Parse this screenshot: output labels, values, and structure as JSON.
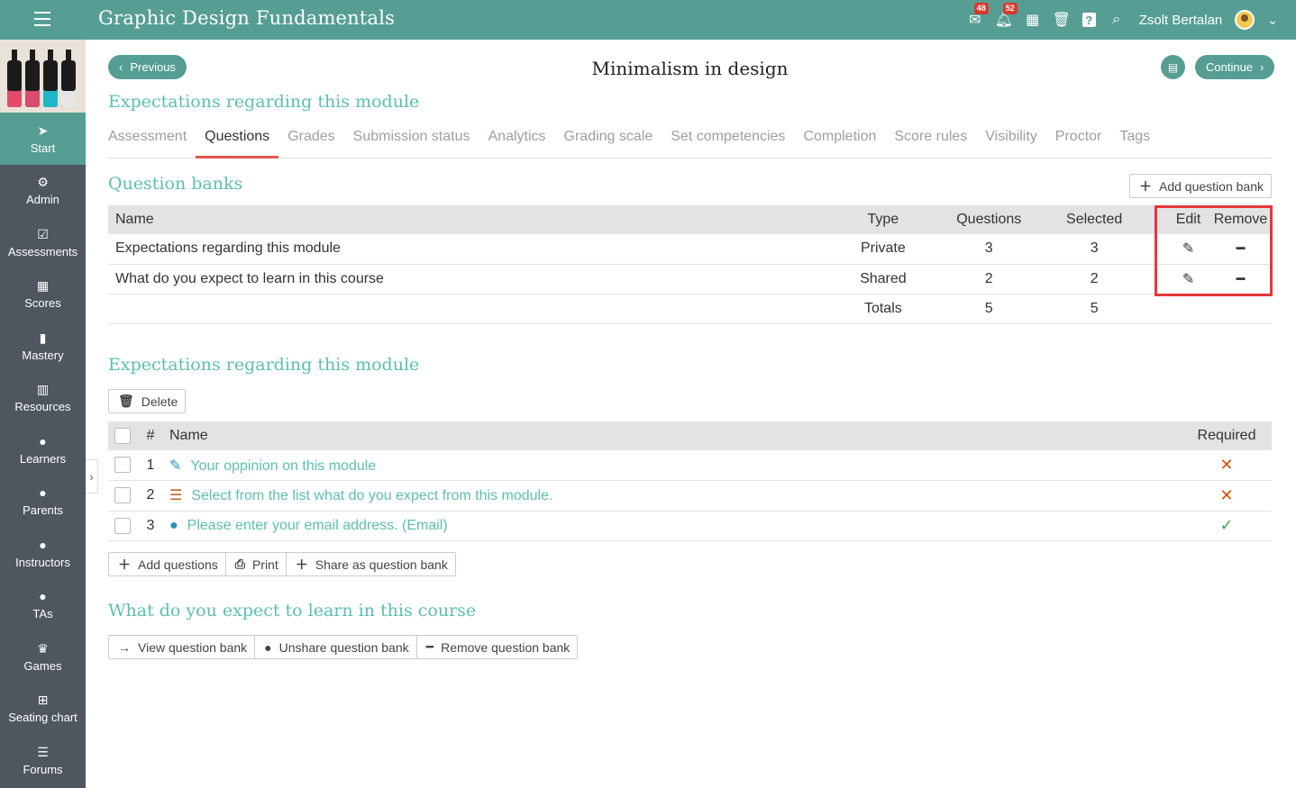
{
  "header": {
    "title": "Graphic Design Fundamentals",
    "messages_badge": "48",
    "notifications_badge": "52",
    "user_name": "Zsolt Bertalan"
  },
  "sidebar": {
    "items": [
      {
        "label": "Start",
        "icon": "➤"
      },
      {
        "label": "Admin",
        "icon": "⚙"
      },
      {
        "label": "Assessments",
        "icon": "☑"
      },
      {
        "label": "Scores",
        "icon": "▦"
      },
      {
        "label": "Mastery",
        "icon": "▮"
      },
      {
        "label": "Resources",
        "icon": "▥"
      },
      {
        "label": "Learners",
        "icon": "●"
      },
      {
        "label": "Parents",
        "icon": "●"
      },
      {
        "label": "Instructors",
        "icon": "●"
      },
      {
        "label": "TAs",
        "icon": "●"
      },
      {
        "label": "Games",
        "icon": "♛"
      },
      {
        "label": "Seating chart",
        "icon": "⊞"
      },
      {
        "label": "Forums",
        "icon": "☰"
      }
    ]
  },
  "nav": {
    "previous": "Previous",
    "continue": "Continue",
    "page_title": "Minimalism in design"
  },
  "module_heading": "Expectations regarding this module",
  "tabs": [
    "Assessment",
    "Questions",
    "Grades",
    "Submission status",
    "Analytics",
    "Grading scale",
    "Set competencies",
    "Completion",
    "Score rules",
    "Visibility",
    "Proctor",
    "Tags"
  ],
  "question_banks": {
    "heading": "Question banks",
    "add_button": "Add question bank",
    "columns": {
      "name": "Name",
      "type": "Type",
      "questions": "Questions",
      "selected": "Selected",
      "edit": "Edit",
      "remove": "Remove"
    },
    "rows": [
      {
        "name": "Expectations regarding this module",
        "type": "Private",
        "questions": "3",
        "selected": "3"
      },
      {
        "name": "What do you expect to learn in this course",
        "type": "Shared",
        "questions": "2",
        "selected": "2"
      }
    ],
    "totals": {
      "label": "Totals",
      "questions": "5",
      "selected": "5"
    }
  },
  "questions_section": {
    "heading": "Expectations regarding this module",
    "delete_button": "Delete",
    "columns": {
      "number": "#",
      "name": "Name",
      "required": "Required"
    },
    "rows": [
      {
        "number": "1",
        "name": "Your oppinion on this module",
        "icon": "✎",
        "icon_color": "#2a8fbd",
        "required": false
      },
      {
        "number": "2",
        "name": "Select from the list what do you expect from this module.",
        "icon": "☰",
        "icon_color": "#c0661a",
        "required": false
      },
      {
        "number": "3",
        "name": "Please enter your email address. (Email)",
        "icon": "●",
        "icon_color": "#2a8fbd",
        "required": true
      }
    ],
    "add_questions": "Add questions",
    "print": "Print",
    "share_as_bank": "Share as question bank"
  },
  "shared_section": {
    "heading": "What do you expect to learn in this course",
    "view_bank": "View question bank",
    "unshare_bank": "Unshare question bank",
    "remove_bank": "Remove question bank"
  },
  "colors": {
    "brand": "#569e94",
    "accent_text": "#5bbfb0",
    "highlight": "#e5383b"
  }
}
